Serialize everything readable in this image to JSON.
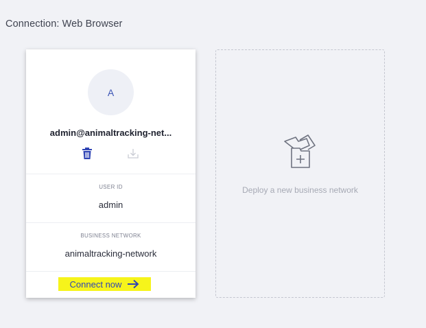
{
  "connection": {
    "title": "Connection: Web Browser"
  },
  "identity_card": {
    "avatar_initial": "A",
    "name": "admin@animaltracking-net...",
    "user_id_label": "USER ID",
    "user_id_value": "admin",
    "network_label": "BUSINESS NETWORK",
    "network_value": "animaltracking-network",
    "connect_label": "Connect now",
    "icons": [
      "trash-icon",
      "export-icon",
      "arrow-right-icon"
    ]
  },
  "deploy_card": {
    "label": "Deploy a new business network",
    "icon": "deploy-network-icon"
  },
  "colors": {
    "background": "#f1f2f6",
    "accent": "#2f44b4",
    "highlight": "#f6f41b",
    "avatar_bg": "#eef0f6"
  }
}
